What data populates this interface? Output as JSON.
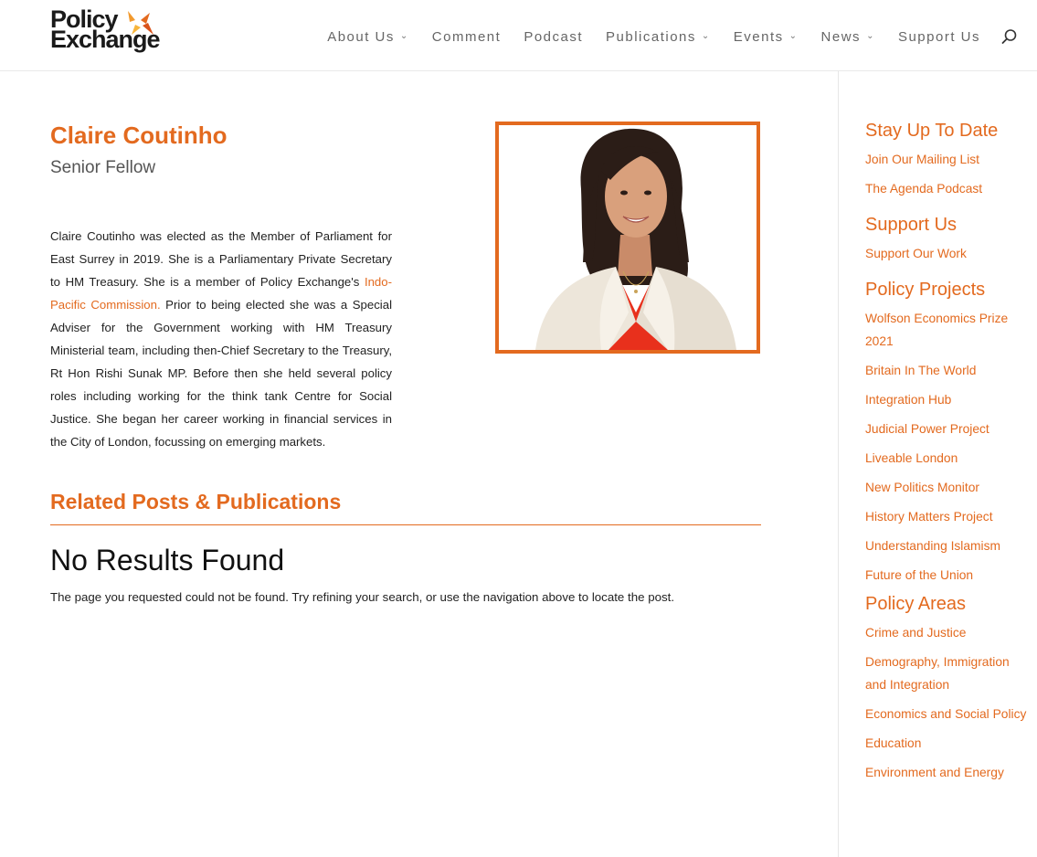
{
  "header": {
    "logo": {
      "line1": "Policy",
      "line2": "Exchange"
    },
    "nav": [
      {
        "label": "About Us",
        "dropdown": true
      },
      {
        "label": "Comment",
        "dropdown": false
      },
      {
        "label": "Podcast",
        "dropdown": false
      },
      {
        "label": "Publications",
        "dropdown": true
      },
      {
        "label": "Events",
        "dropdown": true
      },
      {
        "label": "News",
        "dropdown": true
      },
      {
        "label": "Support Us",
        "dropdown": false
      }
    ],
    "search_icon": "search-icon"
  },
  "profile": {
    "name": "Claire Coutinho",
    "role": "Senior Fellow",
    "bio_part1": "Claire Coutinho was elected as the Member of Parliament for East Surrey in 2019. She is a Parliamentary Private Secretary to HM Treasury. She is a member of Policy Exchange's ",
    "bio_link": "Indo-Pacific Commission.",
    "bio_part2": " Prior to being elected she was a Special Adviser for the Government working with HM Treasury Ministerial team, including then-Chief Secretary to the Treasury, Rt Hon Rishi Sunak MP. Before then she held several policy roles including working for the think tank Centre for Social Justice. She began her career working in financial services in the City of London, focussing on emerging markets."
  },
  "related": {
    "heading": "Related Posts & Publications",
    "no_results_title": "No Results Found",
    "no_results_text": "The page you requested could not be found. Try refining your search, or use the navigation above to locate the post."
  },
  "sidebar": {
    "stay": {
      "heading": "Stay Up To Date",
      "links": [
        "Join Our Mailing List",
        "The Agenda Podcast"
      ]
    },
    "support": {
      "heading": "Support Us",
      "links": [
        "Support Our Work"
      ]
    },
    "projects": {
      "heading": "Policy Projects",
      "links": [
        "Wolfson Economics Prize 2021",
        "Britain In The World",
        "Integration Hub",
        "Judicial Power Project",
        "Liveable London",
        "New Politics Monitor",
        "History Matters Project",
        "Understanding Islamism",
        "Future of the Union"
      ]
    },
    "areas": {
      "heading": "Policy Areas",
      "links": [
        "Crime and Justice",
        "Demography, Immigration and Integration",
        "Economics and Social Policy",
        "Education",
        "Environment and Energy"
      ]
    }
  },
  "colors": {
    "accent": "#e36a1f",
    "text": "#222222",
    "nav": "#666666"
  }
}
